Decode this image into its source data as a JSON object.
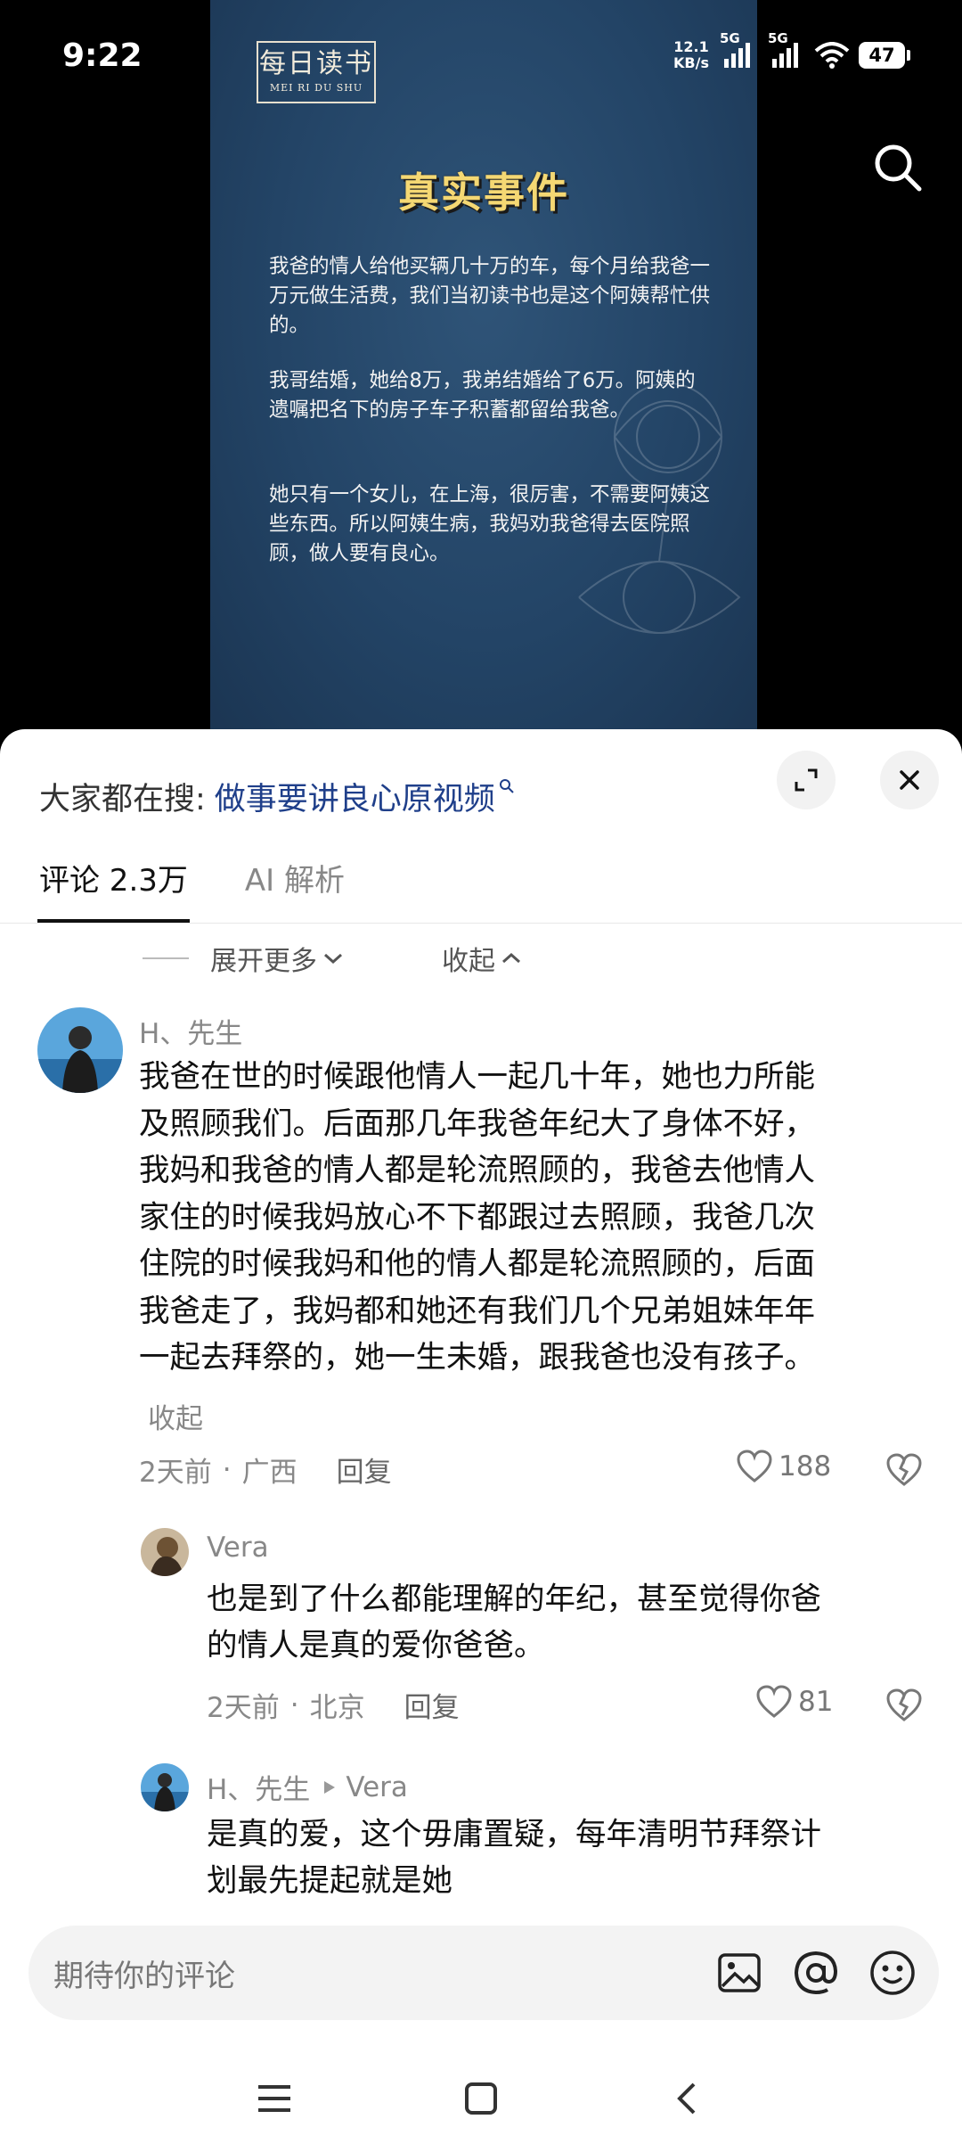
{
  "status_bar": {
    "time": "9:22",
    "net_speed_value": "12.1",
    "net_speed_unit": "KB/s",
    "signal1_label": "5G",
    "signal2_label": "5G",
    "battery": "47"
  },
  "video": {
    "logo_main": "每日读书",
    "logo_sub": "MEI RI DU SHU",
    "title": "真实事件",
    "paragraphs": [
      "我爸的情人给他买辆几十万的车，每个月给我爸一万元做生活费，我们当初读书也是这个阿姨帮忙供的。",
      "我哥结婚，她给8万，我弟结婚给了6万。阿姨的遗嘱把名下的房子车子积蓄都留给我爸。",
      "她只有一个女儿，在上海，很厉害，不需要阿姨这些东西。所以阿姨生病，我妈劝我爸得去医院照顾，做人要有良心。"
    ]
  },
  "search_bar": {
    "label": "大家都在搜:",
    "query": "做事要讲良心原视频"
  },
  "tabs": [
    {
      "label": "评论 2.3万",
      "active": true
    },
    {
      "label": "AI 解析",
      "active": false
    }
  ],
  "expand_row": {
    "expand_label": "展开更多",
    "collapse_label": "收起"
  },
  "comments": {
    "main": {
      "username": "H、先生",
      "lines": [
        "我爸在世的时候跟他情人一起几十年，她也力所能",
        "及照顾我们。后面那几年我爸年纪大了身体不好，",
        "我妈和我爸的情人都是轮流照顾的，我爸去他情人",
        "家住的时候我妈放心不下都跟过去照顾，我爸几次",
        "住院的时候我妈和他的情人都是轮流照顾的，后面",
        "我爸走了，我妈都和她还有我们几个兄弟姐妹年年",
        "一起去拜祭的，她一生未婚，跟我爸也没有孩子。"
      ],
      "collapse": "收起",
      "time": "2天前",
      "location": "广西",
      "reply": "回复",
      "likes": "188"
    },
    "reply1": {
      "username": "Vera",
      "lines": [
        "也是到了什么都能理解的年纪，甚至觉得你爸",
        "的情人是真的爱你爸爸。"
      ],
      "time": "2天前",
      "location": "北京",
      "reply": "回复",
      "likes": "81"
    },
    "reply2": {
      "username": "H、先生",
      "reply_to": "Vera",
      "lines": [
        "是真的爱，这个毋庸置疑，每年清明节拜祭计",
        "划最先提起就是她"
      ]
    }
  },
  "input": {
    "placeholder": "期待你的评论"
  },
  "icons": {
    "search": "search-icon",
    "expand": "expand-icon",
    "close": "close-icon",
    "like": "heart-icon",
    "dislike": "broken-heart-icon",
    "image": "image-icon",
    "mention": "at-icon",
    "emoji": "emoji-icon",
    "nav_menu": "menu-icon",
    "nav_home": "home-square-icon",
    "nav_back": "back-chevron-icon"
  },
  "colors": {
    "search_query": "#1f3f8a",
    "video_bg": "#234466",
    "video_title": "#f5d873"
  }
}
